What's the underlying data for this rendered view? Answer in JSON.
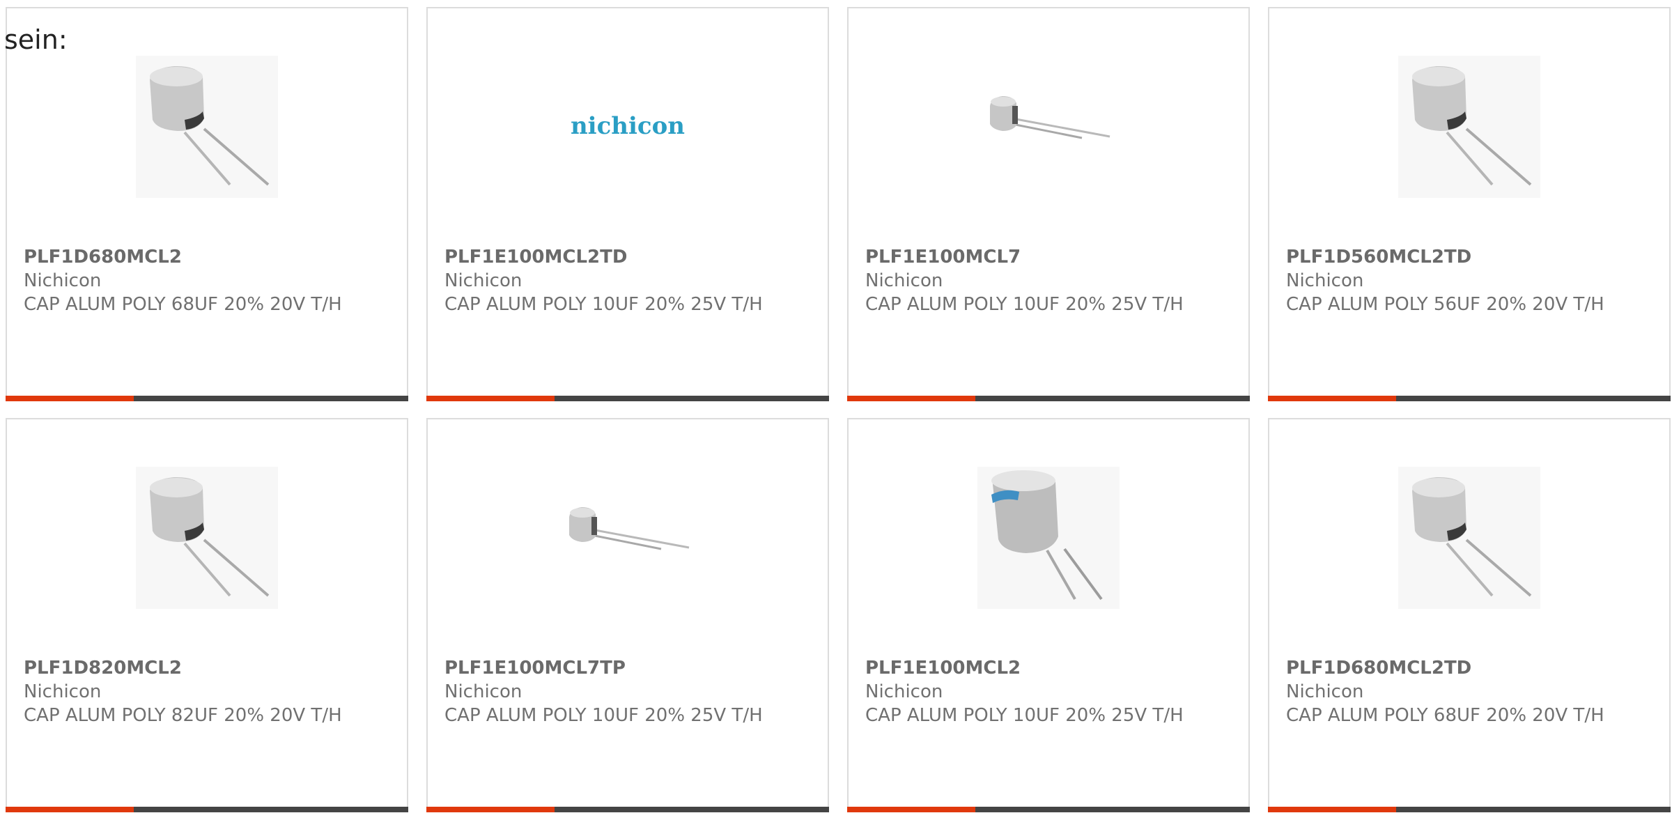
{
  "intro_text": "sein:",
  "colors": {
    "accent_orange": "#e0380c",
    "accent_dark": "#444444",
    "border": "#dcdcdc",
    "text": "#707070"
  },
  "products": [
    {
      "part": "PLF1D680MCL2",
      "manufacturer": "Nichicon",
      "description": "CAP ALUM POLY 68UF 20% 20V T/H",
      "image": "capacitor-photo"
    },
    {
      "part": "PLF1E100MCL2TD",
      "manufacturer": "Nichicon",
      "description": "CAP ALUM POLY 10UF 20% 25V T/H",
      "image": "nichicon-logo",
      "logo_text": "nichicon"
    },
    {
      "part": "PLF1E100MCL7",
      "manufacturer": "Nichicon",
      "description": "CAP ALUM POLY 10UF 20% 25V T/H",
      "image": "capacitor-small-photo"
    },
    {
      "part": "PLF1D560MCL2TD",
      "manufacturer": "Nichicon",
      "description": "CAP ALUM POLY 56UF 20% 20V T/H",
      "image": "capacitor-photo"
    },
    {
      "part": "PLF1D820MCL2",
      "manufacturer": "Nichicon",
      "description": "CAP ALUM POLY 82UF 20% 20V T/H",
      "image": "capacitor-photo"
    },
    {
      "part": "PLF1E100MCL7TP",
      "manufacturer": "Nichicon",
      "description": "CAP ALUM POLY 10UF 20% 25V T/H",
      "image": "capacitor-small-photo"
    },
    {
      "part": "PLF1E100MCL2",
      "manufacturer": "Nichicon",
      "description": "CAP ALUM POLY 10UF 20% 25V T/H",
      "image": "capacitor-blue-top-photo"
    },
    {
      "part": "PLF1D680MCL2TD",
      "manufacturer": "Nichicon",
      "description": "CAP ALUM POLY 68UF 20% 20V T/H",
      "image": "capacitor-photo"
    }
  ]
}
